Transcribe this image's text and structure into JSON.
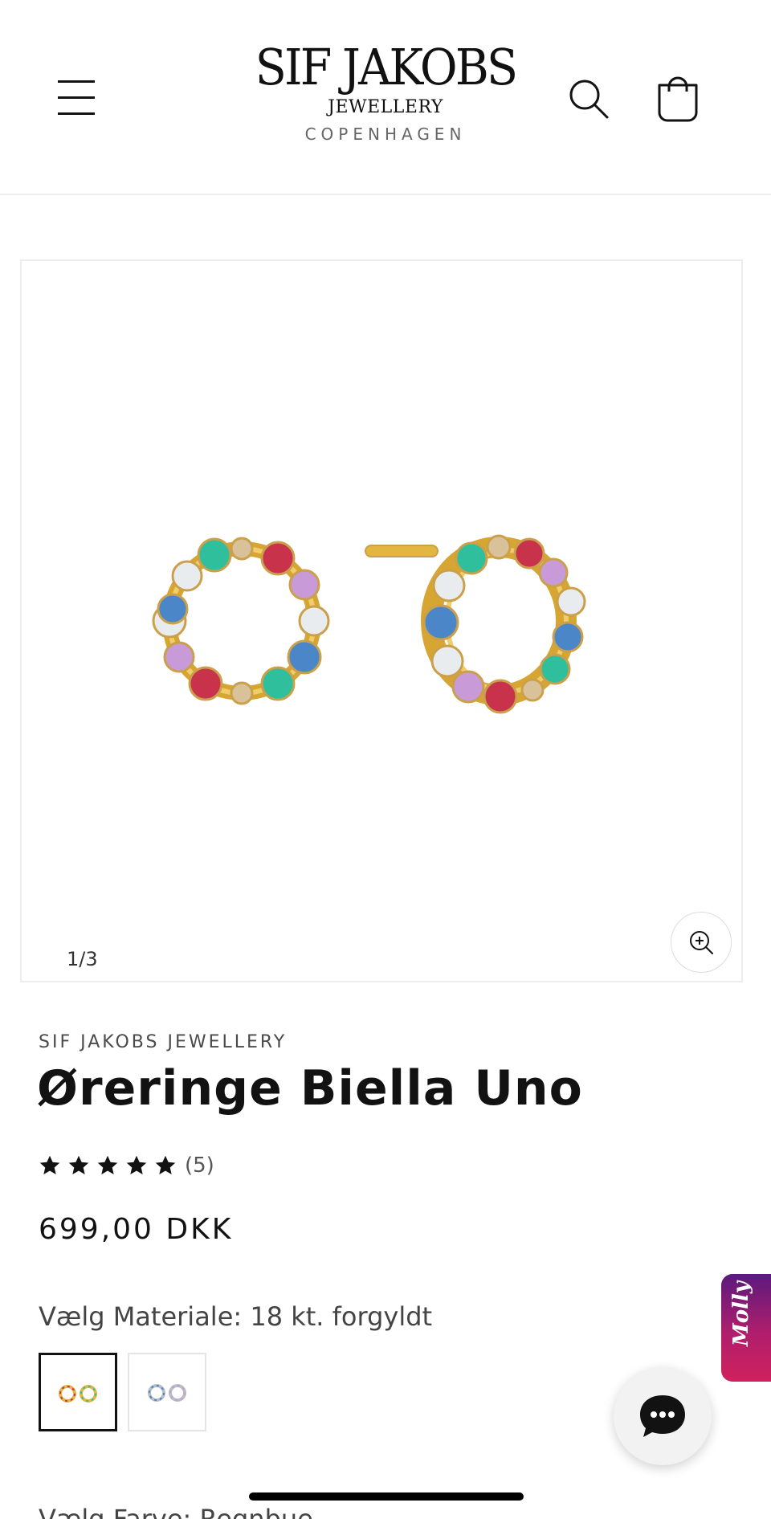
{
  "header": {
    "logo": {
      "brand": "SIF JAKOBS",
      "sub": "JEWELLERY",
      "city": "COPENHAGEN"
    }
  },
  "gallery": {
    "counter": "1/3"
  },
  "product": {
    "vendor": "SIF JAKOBS JEWELLERY",
    "title": "Øreringe Biella Uno",
    "rating": {
      "stars": 5,
      "count_label": "(5)"
    },
    "price": "699,00 DKK",
    "material_label": "Vælg Materiale: 18 kt. forgyldt",
    "color_label": "Vælg Farve: Regnbue"
  },
  "widgets": {
    "molly_label": "Molly"
  },
  "icons": {
    "menu": "hamburger-menu-icon",
    "search": "search-icon",
    "cart": "shopping-bag-icon",
    "zoom": "zoom-in-icon",
    "star": "star-icon",
    "chat": "chat-bubble-icon"
  },
  "colors": {
    "text": "#121212",
    "gold": "#e2b640",
    "stone_red": "#c8324a",
    "stone_green": "#2fbf9c",
    "stone_blue": "#4a86c8",
    "stone_purple": "#c89ad8",
    "stone_champagne": "#d9c29a",
    "stone_white": "#e9ecef",
    "molly_gradient_top": "#5b1a7e",
    "molly_gradient_bottom": "#d0215c"
  }
}
